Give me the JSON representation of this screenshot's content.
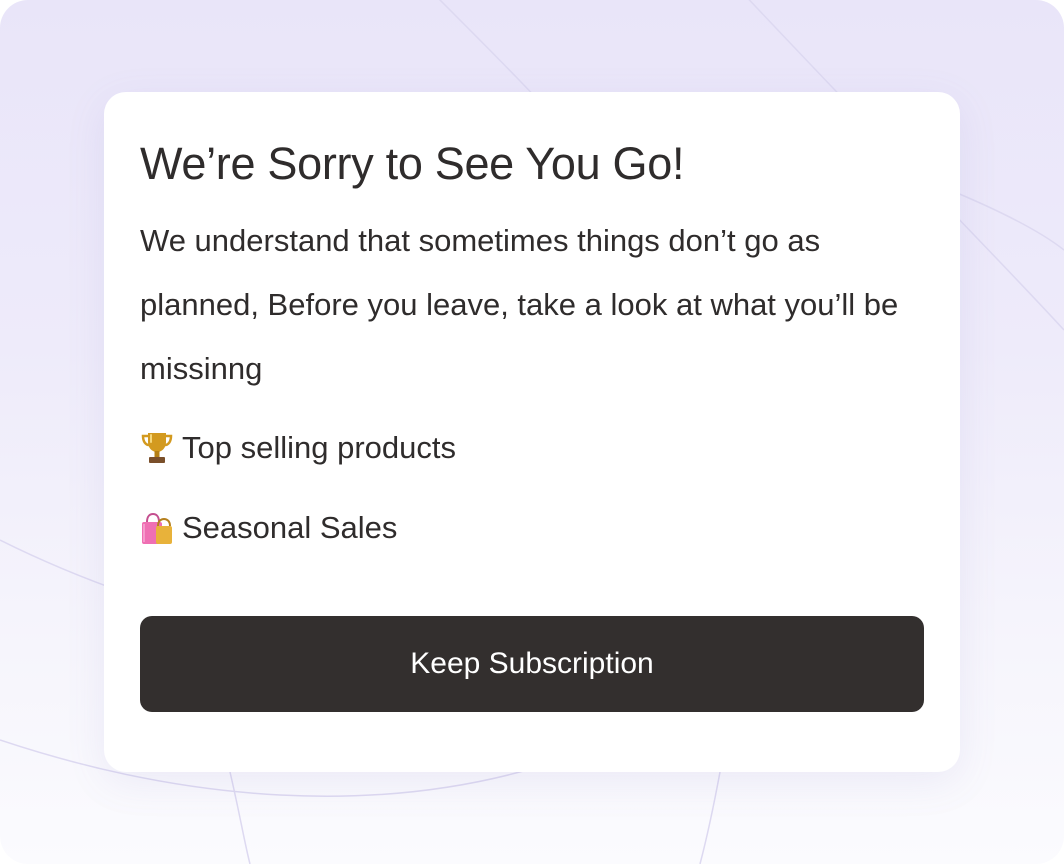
{
  "modal": {
    "title": "We’re Sorry to See You Go!",
    "message": "We understand that sometimes things don’t go as planned, Before you leave, take a look at what you’ll be missinng",
    "features": [
      {
        "icon": "trophy-icon",
        "label": "Top selling products"
      },
      {
        "icon": "shopping-bags-icon",
        "label": "Seasonal Sales"
      }
    ],
    "primary_button_label": "Keep Subscription"
  },
  "colors": {
    "background_top": "#e9e5f9",
    "background_bottom": "#fbfbfe",
    "card": "#ffffff",
    "text": "#2f2c2c",
    "button": "#332f2e",
    "button_text": "#ffffff",
    "trophy": "#d39a1f",
    "bag_pink": "#ef6fb3",
    "bag_gold": "#e8b23a"
  }
}
